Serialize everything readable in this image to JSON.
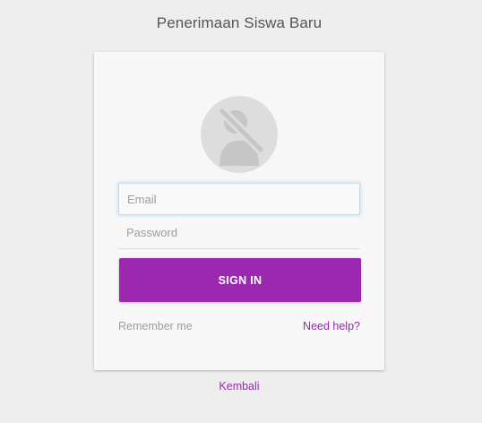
{
  "header": {
    "title": "Penerimaan Siswa Baru"
  },
  "login_card": {
    "avatar_icon": "user-slash-icon",
    "email": {
      "value": "",
      "placeholder": "Email"
    },
    "password": {
      "value": "",
      "placeholder": "Password"
    },
    "signin_label": "SIGN IN",
    "remember_label": "Remember me",
    "help_label": "Need help?"
  },
  "footer": {
    "back_label": "Kembali"
  },
  "colors": {
    "background": "#eeeeee",
    "card": "#f7f7f7",
    "accent": "#9c27b0",
    "muted_text": "#9e9e9e",
    "avatar_bg": "#dddddd",
    "avatar_fg": "#c6c6c6"
  }
}
